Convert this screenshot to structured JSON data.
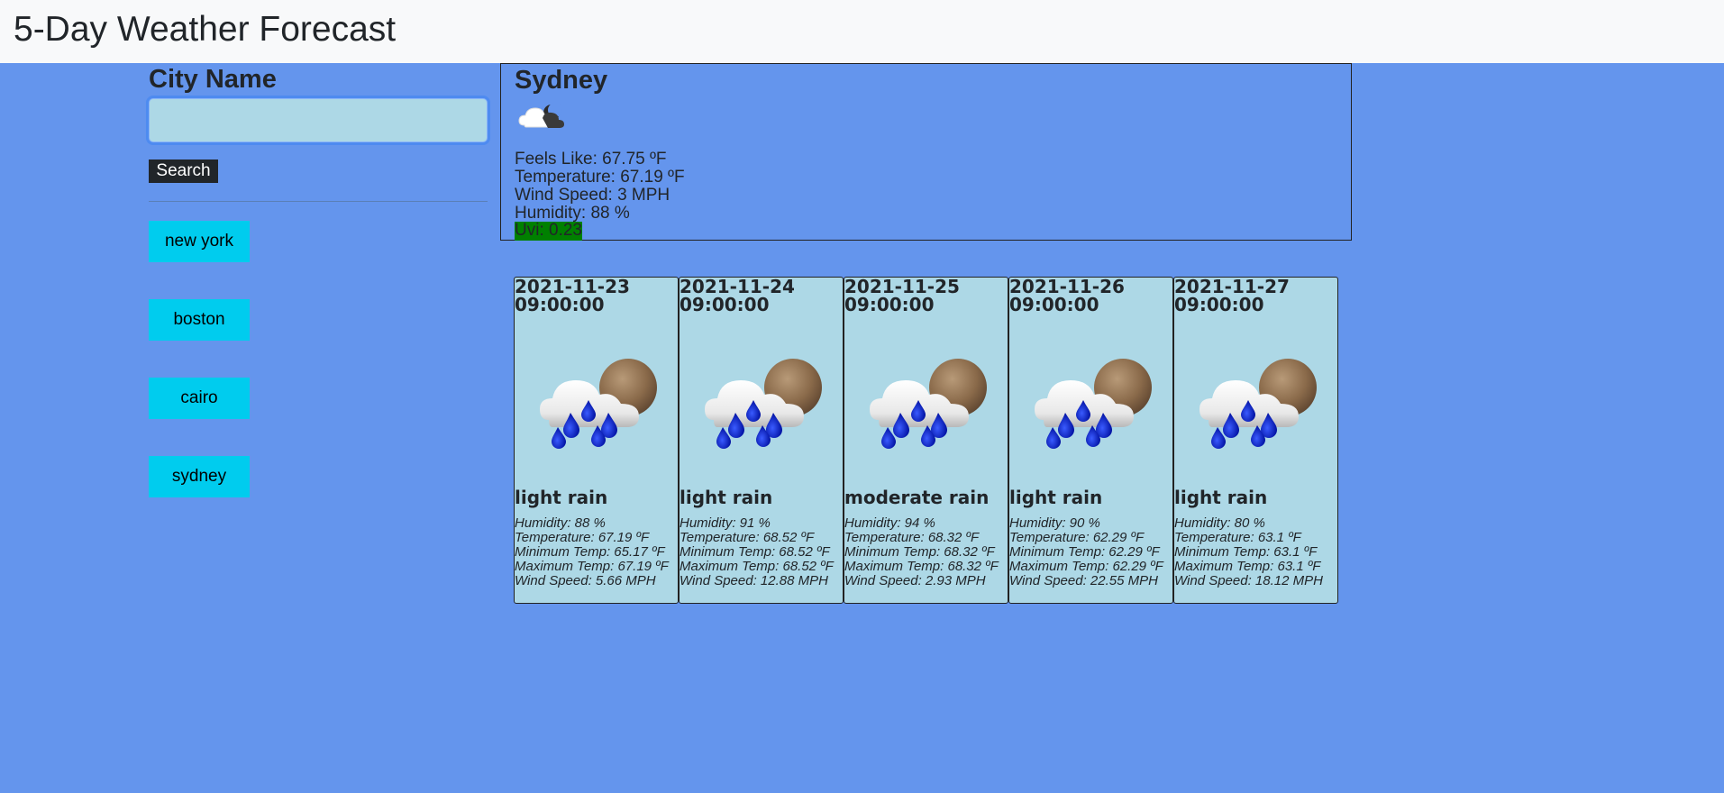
{
  "header": {
    "title": "5-Day Weather Forecast"
  },
  "search": {
    "label": "City Name",
    "value": "",
    "placeholder": "",
    "button_label": "Search"
  },
  "history": [
    {
      "label": "new york"
    },
    {
      "label": "boston"
    },
    {
      "label": "cairo"
    },
    {
      "label": "sydney"
    }
  ],
  "current": {
    "city": "Sydney",
    "icon": "partly-cloudy-night-icon",
    "feels_like": "Feels Like: 67.75 ºF",
    "temperature": "Temperature: 67.19 ºF",
    "wind": "Wind Speed: 3 MPH",
    "humidity": "Humidity: 88 %",
    "uvi": "Uvi: 0.23",
    "uvi_color": "#008000"
  },
  "forecast": [
    {
      "date": "2021-11-23 09:00:00",
      "icon": "rain-night-icon",
      "description": "light rain",
      "humidity": "Humidity: 88 %",
      "temperature": "Temperature: 67.19 ºF",
      "min_temp": "Minimum Temp: 65.17 ºF",
      "max_temp": "Maximum Temp: 67.19 ºF",
      "wind": "Wind Speed: 5.66 MPH"
    },
    {
      "date": "2021-11-24 09:00:00",
      "icon": "rain-night-icon",
      "description": "light rain",
      "humidity": "Humidity: 91 %",
      "temperature": "Temperature: 68.52 ºF",
      "min_temp": "Minimum Temp: 68.52 ºF",
      "max_temp": "Maximum Temp: 68.52 ºF",
      "wind": "Wind Speed: 12.88 MPH"
    },
    {
      "date": "2021-11-25 09:00:00",
      "icon": "rain-night-icon",
      "description": "moderate rain",
      "humidity": "Humidity: 94 %",
      "temperature": "Temperature: 68.32 ºF",
      "min_temp": "Minimum Temp: 68.32 ºF",
      "max_temp": "Maximum Temp: 68.32 ºF",
      "wind": "Wind Speed: 2.93 MPH"
    },
    {
      "date": "2021-11-26 09:00:00",
      "icon": "rain-night-icon",
      "description": "light rain",
      "humidity": "Humidity: 90 %",
      "temperature": "Temperature: 62.29 ºF",
      "min_temp": "Minimum Temp: 62.29 ºF",
      "max_temp": "Maximum Temp: 62.29 ºF",
      "wind": "Wind Speed: 22.55 MPH"
    },
    {
      "date": "2021-11-27 09:00:00",
      "icon": "rain-night-icon",
      "description": "light rain",
      "humidity": "Humidity: 80 %",
      "temperature": "Temperature: 63.1 ºF",
      "min_temp": "Minimum Temp: 63.1 ºF",
      "max_temp": "Maximum Temp: 63.1 ºF",
      "wind": "Wind Speed: 18.12 MPH"
    }
  ],
  "colors": {
    "background": "#6495ED",
    "navbar": "#f8f9fa",
    "card": "#ADD8E6",
    "history_button": "#00CCEE",
    "search_button": "#212529"
  }
}
